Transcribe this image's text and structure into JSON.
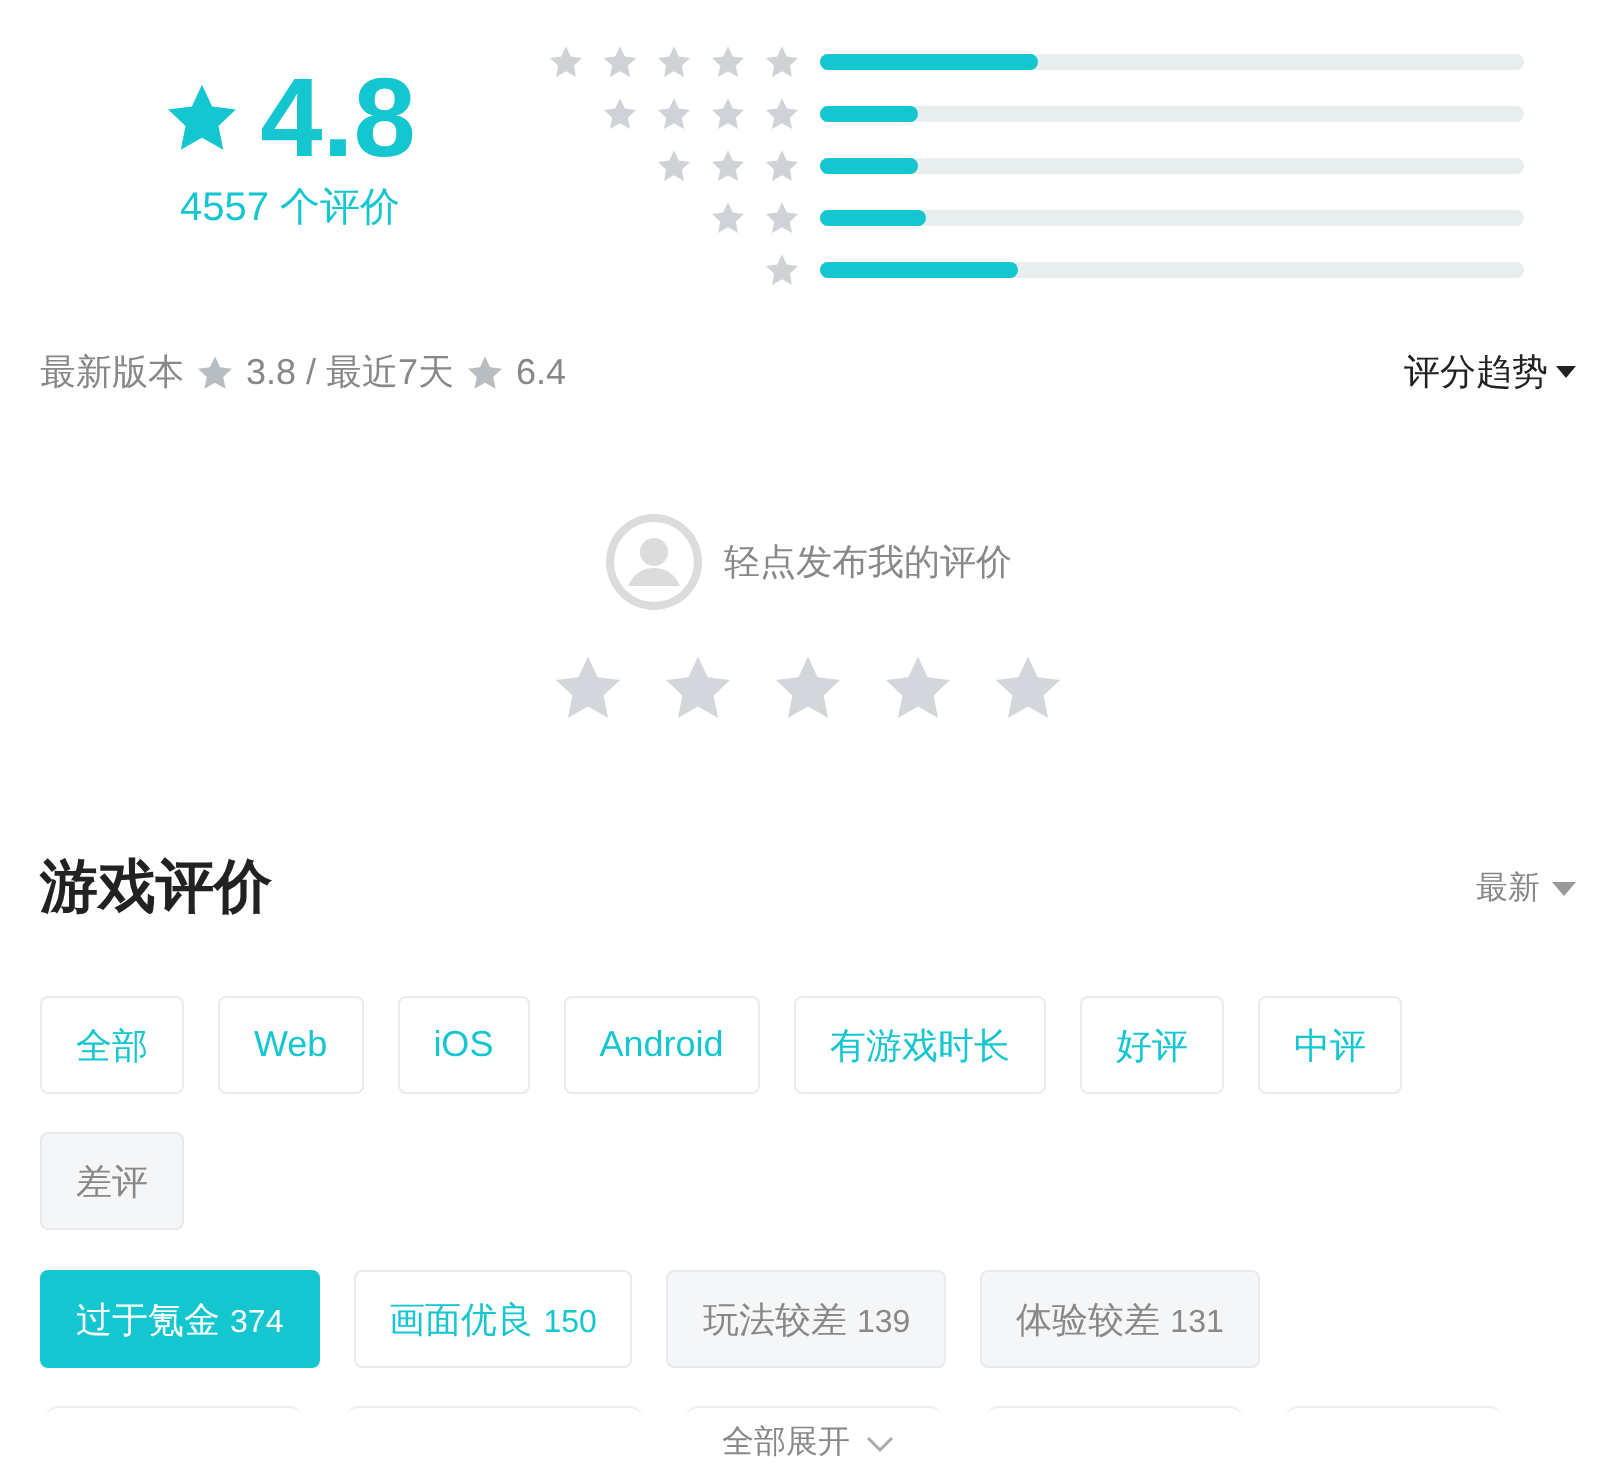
{
  "rating": {
    "score": "4.8",
    "count": "4557 个评价"
  },
  "distribution": [
    {
      "level": 0.31
    },
    {
      "level": 0.14
    },
    {
      "level": 0.14
    },
    {
      "level": 0.15
    },
    {
      "level": 0.28
    }
  ],
  "summary": {
    "latest_label": "最新版本",
    "latest_score": "3.8 / 最近7天",
    "recent_score": "6.4",
    "trend": "评分趋势"
  },
  "compose": {
    "prompt": "轻点发布我的评价",
    "stars": 0
  },
  "reviews": {
    "title": "游戏评价",
    "sort": "最新"
  },
  "filters": [
    {
      "label": "全部",
      "kind": "outlined",
      "selected": false
    },
    {
      "label": "Web",
      "kind": "outlined",
      "selected": false
    },
    {
      "label": "iOS",
      "kind": "outlined",
      "selected": false
    },
    {
      "label": "Android",
      "kind": "outlined",
      "selected": false
    },
    {
      "label": "有游戏时长",
      "kind": "outlined",
      "selected": false
    },
    {
      "label": "好评",
      "kind": "outlined",
      "selected": false
    },
    {
      "label": "中评",
      "kind": "outlined",
      "selected": false
    },
    {
      "label": "差评",
      "kind": "muted",
      "selected": false
    }
  ],
  "tags": [
    {
      "label": "过于氪金",
      "count": "374",
      "kind": "muted",
      "selected": true
    },
    {
      "label": "画面优良",
      "count": "150",
      "kind": "outlined",
      "selected": false
    },
    {
      "label": "玩法较差",
      "count": "139",
      "kind": "muted",
      "selected": false
    },
    {
      "label": "体验较差",
      "count": "131",
      "kind": "muted",
      "selected": false
    }
  ],
  "expand": "全部展开"
}
